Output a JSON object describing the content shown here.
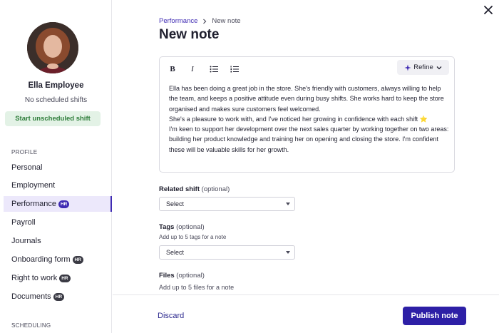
{
  "sidebar": {
    "employee_name": "Ella Employee",
    "shift_status": "No scheduled shifts",
    "start_shift_label": "Start unscheduled shift",
    "profile_section": "PROFILE",
    "scheduling_section": "SCHEDULING",
    "items": [
      {
        "label": "Personal",
        "hr": false,
        "active": false
      },
      {
        "label": "Employment",
        "hr": false,
        "active": false
      },
      {
        "label": "Performance",
        "hr": true,
        "active": true
      },
      {
        "label": "Payroll",
        "hr": false,
        "active": false
      },
      {
        "label": "Journals",
        "hr": false,
        "active": false
      },
      {
        "label": "Onboarding form",
        "hr": true,
        "active": false
      },
      {
        "label": "Right to work",
        "hr": true,
        "active": false
      },
      {
        "label": "Documents",
        "hr": true,
        "active": false
      }
    ],
    "hr_badge": "HR"
  },
  "breadcrumb": {
    "parent": "Performance",
    "current": "New note"
  },
  "page_title": "New note",
  "editor": {
    "refine_label": "Refine",
    "lines": [
      "Ella has been doing a great job in the store. She's friendly with customers, always willing to help the team, and keeps a positive attitude even during busy shifts. She works hard to keep the store organised and makes sure customers feel welcomed.",
      "She's a pleasure to work with, and I've noticed her growing in confidence with each shift ⭐",
      "I'm keen to support her development over the next sales quarter by working together on two areas: building her product knowledge and training her on opening and closing the store. I'm confident these will be valuable skills for her growth."
    ]
  },
  "related_shift": {
    "label": "Related shift",
    "optional": "(optional)",
    "value": "Select"
  },
  "tags": {
    "label": "Tags",
    "optional": "(optional)",
    "help": "Add up to 5 tags for a note",
    "value": "Select"
  },
  "files": {
    "label": "Files",
    "optional": "(optional)",
    "help": "Add up to 5 files for a note"
  },
  "footer": {
    "discard_label": "Discard",
    "publish_label": "Publish note"
  },
  "colors": {
    "accent": "#2d1fa6",
    "link": "#3f2bb3",
    "success_bg": "#e3f2e6",
    "success_text": "#2e7d3a"
  }
}
